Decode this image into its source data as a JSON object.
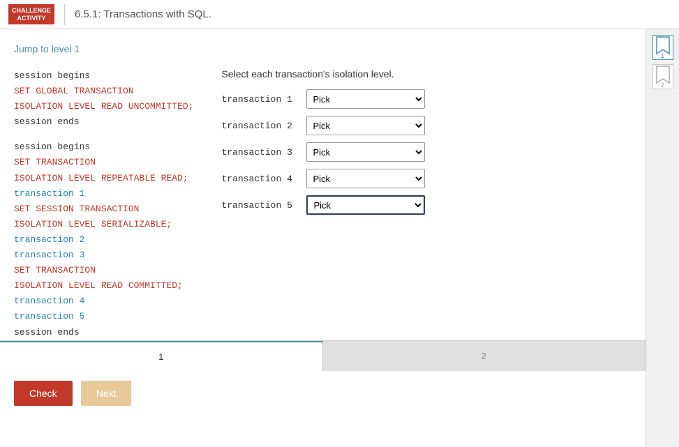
{
  "header": {
    "badge_line1": "CHALLENGE",
    "badge_line2": "ACTIVITY",
    "title": "6.5.1: Transactions with SQL."
  },
  "sidebar": {
    "levels": [
      {
        "label": "1",
        "active": true
      },
      {
        "label": "2",
        "active": false
      }
    ]
  },
  "content": {
    "jump_to_level": "Jump to level 1",
    "code_lines_top": [
      {
        "parts": [
          {
            "text": "session begins",
            "class": "kw-normal"
          }
        ]
      },
      {
        "parts": [
          {
            "text": "SET GLOBAL TRANSACTION",
            "class": "kw-orange"
          }
        ]
      },
      {
        "parts": [
          {
            "text": "ISOLATION LEVEL READ UNCOMMITTED;",
            "class": "kw-orange"
          }
        ]
      },
      {
        "parts": [
          {
            "text": "session ends",
            "class": "kw-normal"
          }
        ]
      }
    ],
    "code_lines_bottom": [
      {
        "parts": [
          {
            "text": "session begins",
            "class": "kw-normal"
          }
        ]
      },
      {
        "parts": [
          {
            "text": "SET TRANSACTION",
            "class": "kw-orange"
          }
        ]
      },
      {
        "parts": [
          {
            "text": "ISOLATION LEVEL REPEATABLE READ;",
            "class": "kw-orange"
          }
        ]
      },
      {
        "parts": [
          {
            "text": "transaction 1",
            "class": "kw-blue"
          }
        ]
      },
      {
        "parts": [
          {
            "text": "SET SESSION TRANSACTION",
            "class": "kw-orange"
          }
        ]
      },
      {
        "parts": [
          {
            "text": "ISOLATION LEVEL SERIALIZABLE;",
            "class": "kw-orange"
          }
        ]
      },
      {
        "parts": [
          {
            "text": "transaction 2",
            "class": "kw-blue"
          }
        ]
      },
      {
        "parts": [
          {
            "text": "transaction 3",
            "class": "kw-blue"
          }
        ]
      },
      {
        "parts": [
          {
            "text": "SET TRANSACTION",
            "class": "kw-orange"
          }
        ]
      },
      {
        "parts": [
          {
            "text": "ISOLATION LEVEL READ COMMITTED;",
            "class": "kw-orange"
          }
        ]
      },
      {
        "parts": [
          {
            "text": "transaction 4",
            "class": "kw-blue"
          }
        ]
      },
      {
        "parts": [
          {
            "text": "transaction 5",
            "class": "kw-blue"
          }
        ]
      },
      {
        "parts": [
          {
            "text": "session ends",
            "class": "kw-normal"
          }
        ]
      }
    ],
    "isolation_section": {
      "title": "Select each transaction's isolation level.",
      "rows": [
        {
          "label": "transaction 1",
          "id": "t1"
        },
        {
          "label": "transaction 2",
          "id": "t2"
        },
        {
          "label": "transaction 3",
          "id": "t3"
        },
        {
          "label": "transaction 4",
          "id": "t4"
        },
        {
          "label": "transaction 5",
          "id": "t5"
        }
      ],
      "options": [
        "Pick",
        "READ UNCOMMITTED",
        "READ COMMITTED",
        "REPEATABLE READ",
        "SERIALIZABLE"
      ]
    }
  },
  "tabs": [
    {
      "label": "1",
      "active": true
    },
    {
      "label": "2",
      "active": false
    }
  ],
  "buttons": {
    "check": "Check",
    "next": "Next"
  }
}
